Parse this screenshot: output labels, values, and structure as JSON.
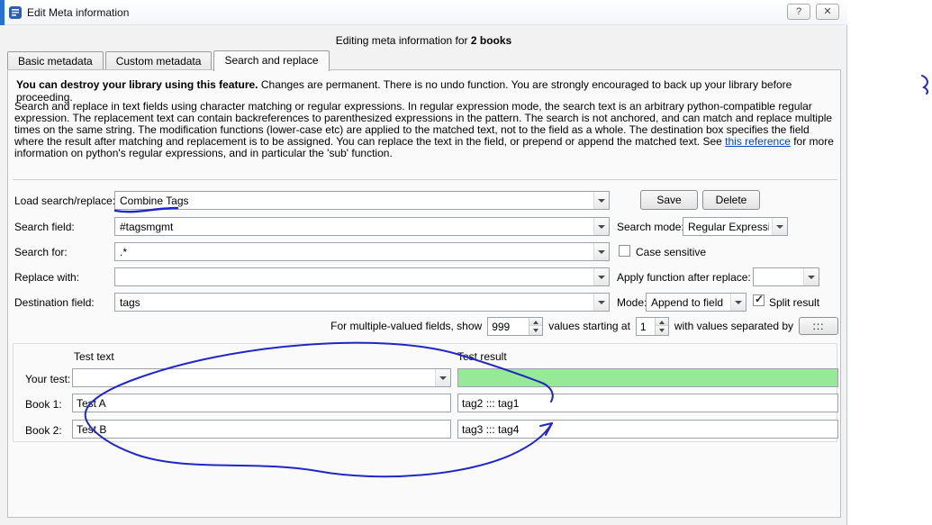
{
  "window": {
    "title": "Edit Meta information",
    "help_glyph": "?",
    "close_glyph": "✕"
  },
  "header": {
    "prefix": "Editing meta information for ",
    "count": "2 books"
  },
  "tabs": {
    "basic": "Basic metadata",
    "custom": "Custom metadata",
    "search": "Search and replace"
  },
  "warning": {
    "bold": "You can destroy your library using this feature.",
    "text": " Changes are permanent. There is no undo function. You are strongly encouraged to back up your library before proceeding."
  },
  "description": {
    "before_link": "Search and replace in text fields using character matching or regular expressions. In regular expression mode, the search text is an arbitrary python-compatible regular expression. The replacement text can contain backreferences to parenthesized expressions in the pattern. The search is not anchored, and can match and replace multiple times on the same string. The modification functions (lower-case etc) are applied to the matched text, not to the field as a whole. The destination box specifies the field where the result after matching and replacement is to be assigned. You can replace the text in the field, or prepend or append the matched text. See ",
    "link": "this reference",
    "after_link": " for more information on python's regular expressions, and in particular the 'sub' function."
  },
  "form": {
    "load_label": "Load search/replace:",
    "load_value": "Combine Tags",
    "save": "Save",
    "delete": "Delete",
    "search_field_label": "Search field:",
    "search_field_value": "#tagsmgmt",
    "search_mode_label": "Search mode:",
    "search_mode_value": "Regular Expression",
    "search_for_label": "Search for:",
    "search_for_value": ".*",
    "case_sensitive": "Case sensitive",
    "replace_with_label": "Replace with:",
    "replace_with_value": "",
    "apply_function_label": "Apply function after replace:",
    "apply_function_value": "",
    "destination_label": "Destination field:",
    "destination_value": "tags",
    "mode_label": "Mode:",
    "mode_value": "Append to field",
    "split_result": "Split result",
    "check_glyph": "✓",
    "multi": {
      "show_label": "For multiple-valued fields, show",
      "show_value": "999",
      "start_label": "values starting at",
      "start_value": "1",
      "sep_label": "with values separated by",
      "sep_button": ":::"
    }
  },
  "test": {
    "text_header": "Test text",
    "result_header": "Test result",
    "rows": [
      {
        "label": "Your test:",
        "value": "",
        "result": ""
      },
      {
        "label": "Book 1:",
        "value": "Test A",
        "result": "tag2 ::: tag1"
      },
      {
        "label": "Book 2:",
        "value": "Test B",
        "result": "tag3 ::: tag4"
      }
    ]
  },
  "colors": {
    "annotation_ink": "#1f27c8",
    "result_ok_background": "#97e897",
    "link": "#0044cc",
    "frame_accent": "#2a6fd3"
  }
}
